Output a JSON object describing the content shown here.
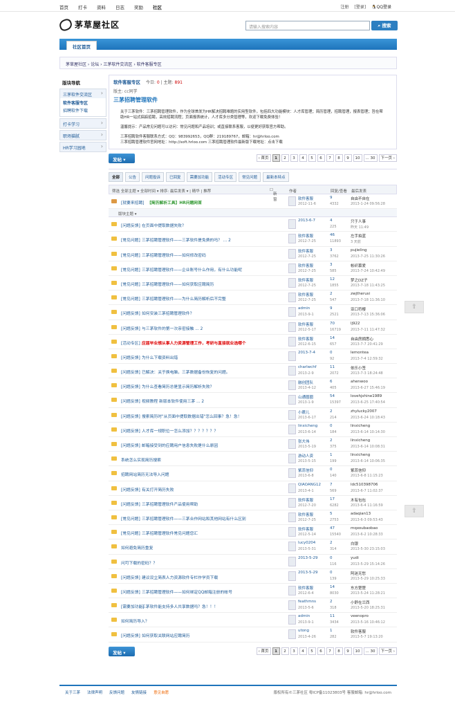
{
  "topnav": {
    "links": [
      "首页",
      "打卡",
      "资料",
      "日志",
      "奖励",
      "社区"
    ],
    "active": "社区",
    "right": [
      "注册",
      "[登录]"
    ],
    "qq_login": "QQ登录"
  },
  "header": {
    "logo_text": "茅草屋社区",
    "search_placeholder": "请输入搜索内容",
    "search_button": "搜索"
  },
  "tabbar": {
    "tab": "社区首页"
  },
  "breadcrumb": "茅草屋社区 › 论坛 › 三茅软件交流区 › 软件客服专区",
  "sidebar": {
    "title": "版块导航",
    "groups": [
      {
        "label": "三茅软件交流区",
        "subs": [
          "软件客服专区",
          "招聘软件下载"
        ]
      },
      {
        "label": "打卡学习",
        "subs": []
      },
      {
        "label": "职场猫腻",
        "subs": []
      },
      {
        "label": "HR学习园地",
        "subs": []
      }
    ]
  },
  "forum": {
    "name": "软件客服专区",
    "today_label": "今日:",
    "today": "0",
    "topics_label": "主题:",
    "topics": "891",
    "moderator": "版主: cc同学",
    "ad": "三茅招聘管理软件",
    "desc1": "关于三茅软件：三茅招聘管理软件，作为全球首发为HR解决招聘难题的实用型软件，包括四大功能模块：人才库管理；简历管理，招聘管理，报表管理；旨在帮助HR一站式搞掂招聘，高效招聘流程；页面报表统计，人才库多分类管理等，欢迎下载免费体验！",
    "desc2": "温馨提示：产品常见问题可以访问：常见问题和产品培训；或直接联系客服，以便更好获取官方帮助。",
    "desc3": "三茅招聘软件客服联系方式：QQ：983992653，QQ群：219189767，邮箱：hr@hrloo.com",
    "desc4": "三茅招聘管理软件官网地址：http://soft.hrloo.com    三茅招聘管理软件最新版下载地址：点击下载"
  },
  "toolbar": {
    "post_button": "发帖",
    "pager": [
      "‹ 首页",
      "1",
      "2",
      "3",
      "4",
      "5",
      "6",
      "7",
      "8",
      "9",
      "10",
      "... 30",
      "下一页 ›"
    ]
  },
  "filters": [
    "全部",
    "公告",
    "问题投诉",
    "已回复",
    "需要加功能",
    "活动专区",
    "常见问题",
    "最新本特点"
  ],
  "threadhead": {
    "sort": "筛选  全部主题 ▾  全部时间 ▾  排序: 最后发表 ▾  | 精华 | 推荐",
    "newwin": "新窗",
    "author": "作者",
    "replies": "回复/查看",
    "last": "最后发表"
  },
  "sticky": {
    "tag": "[就要来招聘]",
    "title": "【简历解析工具】HR问题网首",
    "au": "软件客服",
    "dt": "2012-11-6",
    "rp": "9",
    "vw": "4332",
    "lu": "自由不自在",
    "lt": "2013-1-24 09:56:28"
  },
  "separator": "版块主题",
  "threads": [
    {
      "tag": "[问题反馈]",
      "title": "在页面中提取数据失败？",
      "au": "2013-6-7",
      "dt": "",
      "rp": "4",
      "vw": "225",
      "lu": "只于人事",
      "lt": "昨天 11:49"
    },
    {
      "tag": "[常见问题]",
      "title": "三茅招聘管理软件——三茅软件是免费的吗？ ... 2",
      "au": "软件客服",
      "dt": "2012-7-25",
      "rp": "46",
      "vw": "11893",
      "lu": "左手拍蓝",
      "lt": "3 天前"
    },
    {
      "tag": "[常见问题]",
      "title": "三茅招聘管理软件——如何修改密码",
      "au": "软件客服",
      "dt": "2012-7-25",
      "rp": "3",
      "vw": "3762",
      "lu": "pujieling",
      "lt": "2013-7-25 11:30:26"
    },
    {
      "tag": "[常见问题]",
      "title": "三茅招聘管理软件——企业账号什么作用，有什么功能呢",
      "au": "软件客服",
      "dt": "2012-7-25",
      "rp": "3",
      "vw": "585",
      "lu": "帐织慕爱",
      "lt": "2013-7-24 10:42:49"
    },
    {
      "tag": "[常见问题]",
      "title": "三茅招聘管理软件——如何获取应聘简历",
      "au": "软件客服",
      "dt": "2012-7-25",
      "rp": "12",
      "vw": "1855",
      "lu": "梦之DZ子",
      "lt": "2013-7-18 11:43:25"
    },
    {
      "tag": "[常见问题]",
      "title": "三茅招聘管理软件——为什么简历解析后不完整",
      "au": "软件客服",
      "dt": "2012-7-25",
      "rp": "2",
      "vw": "547",
      "lu": "zwjtherusi",
      "lt": "2013-7-18 11:36:10"
    },
    {
      "tag": "[问题反馈]",
      "title": "如何安装三茅招聘管理软件？",
      "au": "admin",
      "dt": "2013-9-1",
      "rp": "9",
      "vw": "2521",
      "lu": "亚口符樱",
      "lt": "2013-7-13 15:36:06"
    },
    {
      "tag": "[问题反馈]",
      "title": "与三茅软件的第一次亲密接触 ... 2",
      "au": "软件客服",
      "dt": "2012-5-17",
      "rp": "70",
      "vw": "16719",
      "lu": "lj922",
      "lt": "2013-7-11 11:47:32"
    },
    {
      "tag": "[活动专区]",
      "title": "应届毕业想从事人力资源管理工作，考研与直接就业选哪个",
      "au": "软件客服",
      "dt": "2012-6-15",
      "rp": "14",
      "vw": "657",
      "lu": "自由房拥悉心",
      "lt": "2013-7-7 20:41:29",
      "red": true
    },
    {
      "tag": "[问题反馈]",
      "title": "为什么下载资料出错",
      "au": "2013-7-4",
      "dt": "",
      "rp": "0",
      "vw": "92",
      "lu": "lemontea",
      "lt": "2013-7-4 12:59:32"
    },
    {
      "tag": "[问题反馈]",
      "title": "已解决：关于换电脑，三茅数据备份恢复的问题。",
      "au": "charlwchf",
      "dt": "2013-2-9",
      "rp": "11",
      "vw": "2072",
      "lu": "依乐小签",
      "lt": "2013-7-3 18:24:48"
    },
    {
      "tag": "[问题反馈]",
      "title": "为什么查看简历总是显示简历解析失败？",
      "au": "融创团队",
      "dt": "2013-4-12",
      "rp": "6",
      "vw": "405",
      "lu": "ahenwoo",
      "lt": "2013-6-27 15:46:19"
    },
    {
      "tag": "[问题反馈]",
      "title": "视频教程 新版本软件使用三茅 ... 2",
      "au": "山通圈圈",
      "dt": "2013-1-9",
      "rp": "54",
      "vw": "15397",
      "lu": "lovehjshine1989",
      "lt": "2013-6-25 17:40:54"
    },
    {
      "tag": "[问题反馈]",
      "title": "搜索简历时\"从页面中提取数据出错\"怎么回事？急！急！",
      "au": "小蕨儿",
      "dt": "2013-6-17",
      "rp": "2",
      "vw": "214",
      "lu": "zhylucky2007",
      "lt": "2013-6-24 10:18:43"
    },
    {
      "tag": "[问题反馈]",
      "title": "人才库一规职位一怎么添加？？？？？？？",
      "au": "linxicheng",
      "dt": "2013-6-14",
      "rp": "0",
      "vw": "184",
      "lu": "linxicheng",
      "lt": "2013-6-14 10:14:30"
    },
    {
      "tag": "[问题反馈]",
      "title": "邮箱接受到的应聘用户信息失败是什么原因",
      "au": "张大伟",
      "dt": "2013-5-19",
      "rp": "2",
      "vw": "375",
      "lu": "linxicheng",
      "lt": "2013-6-14 10:08:31"
    },
    {
      "tag": "",
      "title": "系统怎么实现简历搜索",
      "au": "游动人资",
      "dt": "2013-5-15",
      "rp": "1",
      "vw": "199",
      "lu": "linxicheng",
      "lt": "2013-6-14 10:06:35"
    },
    {
      "tag": "",
      "title": "招聘网站简历无法导入问题",
      "au": "紫蕊信仰",
      "dt": "2013-6-8",
      "rp": "0",
      "vw": "140",
      "lu": "紫蕊信仰",
      "lt": "2013-6-8 11:15:23"
    },
    {
      "tag": "[问题反馈]",
      "title": "有关打开简历失败",
      "au": "QIAOANG12",
      "dt": "2013-4-1",
      "rp": "7",
      "vw": "569",
      "lu": "ldc510398706",
      "lt": "2013-6-7 11:02:37"
    },
    {
      "tag": "[问题反馈]",
      "title": "三茅招聘管理软件产品使用帮助",
      "au": "软件客服",
      "dt": "2012-7-20",
      "rp": "17",
      "vw": "6282",
      "lu": "木有包包",
      "lt": "2013-6-4 11:16:59"
    },
    {
      "tag": "[常见问题]",
      "title": "三茅招聘管理软件——三茅合作网站和其他网站有什么区别",
      "au": "软件客服",
      "dt": "2012-7-25",
      "rp": "5",
      "vw": "2753",
      "lu": "adaqian13",
      "lt": "2013-6-3 09:53:43"
    },
    {
      "tag": "[常见问题]",
      "title": "三茅招聘管理软件常见问题您汇",
      "au": "软件客服",
      "dt": "2012-5-14",
      "rp": "47",
      "vw": "15540",
      "lu": "mqxoubaobao",
      "lt": "2013-6-2 10:28:33"
    },
    {
      "tag": "",
      "title": "如何避免简历重复",
      "au": "lucy0204",
      "dt": "2013-5-31",
      "rp": "2",
      "vw": "314",
      "lu": "白银",
      "lt": "2013-5-30 23:15:03"
    },
    {
      "tag": "",
      "title": "问可下载的密码？？",
      "au": "2013-5-29",
      "dt": "",
      "rp": "0",
      "vw": "116",
      "lu": "yudi",
      "lt": "2013-5-29 15:14:26"
    },
    {
      "tag": "[问题反馈]",
      "title": "建议设立简表人力资源软件专栏作学员下载",
      "au": "2013-5-29",
      "dt": "",
      "rp": "0",
      "vw": "139",
      "lu": "阿迷无愁",
      "lt": "2013-5-29 10:25:33"
    },
    {
      "tag": "[问题反馈]",
      "title": "三茅招聘管理软件——如何绑定QQ邮箱注册的帐号",
      "au": "软件客服",
      "dt": "2012-6-4",
      "rp": "14",
      "vw": "8030",
      "lu": "东方楚楚",
      "lt": "2013-5-24 11:28:21"
    },
    {
      "tag": "[需要加功能]",
      "title": "三茅软件能支持多人共享数据吗？急！！！",
      "au": "feathmns",
      "dt": "2013-5-6",
      "rp": "2",
      "vw": "318",
      "lu": "小舒在兰西",
      "lt": "2013-5-20 18:25:31"
    },
    {
      "tag": "",
      "title": "如何简历导入？",
      "au": "admin",
      "dt": "2013-9-1",
      "rp": "11",
      "vw": "3434",
      "lu": "veenopro",
      "lt": "2013-5-16 10:46:12"
    },
    {
      "tag": "[问题反馈]",
      "title": "如何获取关联网站应聘简历",
      "au": "utong",
      "dt": "2013-4-26",
      "rp": "1",
      "vw": "282",
      "lu": "软件客服",
      "lt": "2013-5-7 19:13:20"
    }
  ],
  "footer": {
    "links": [
      "关于三茅",
      "法律声明",
      "反馈问题",
      "友情链接",
      "意见自愿"
    ],
    "right": "版权所有©三茅社区 粤ICP备11023803号    客服邮箱: hr@hrloo.com"
  },
  "top_button_icon": "arrow-up-icon"
}
